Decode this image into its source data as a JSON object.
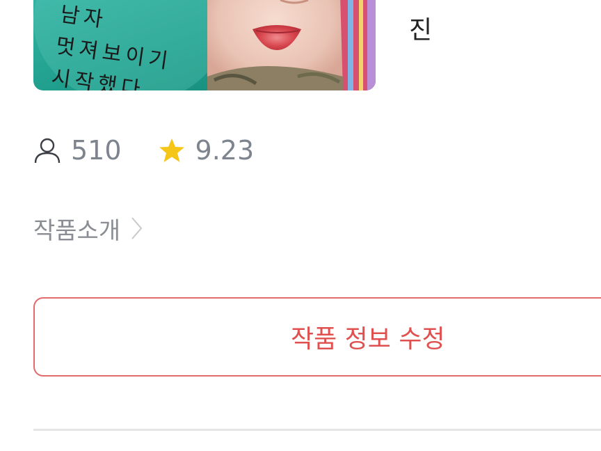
{
  "cover": {
    "handwriting_lines": [
      "남자",
      "멋져보이기",
      "시작했다。"
    ]
  },
  "author": {
    "name": "진"
  },
  "stats": {
    "views": "510",
    "rating": "9.23",
    "view_icon": "person-icon",
    "rating_icon": "star-icon",
    "star_color": "#f5c518"
  },
  "intro": {
    "label": "작품소개"
  },
  "actions": {
    "edit_label": "작품 정보 수정",
    "accent_color": "#e0504f"
  }
}
